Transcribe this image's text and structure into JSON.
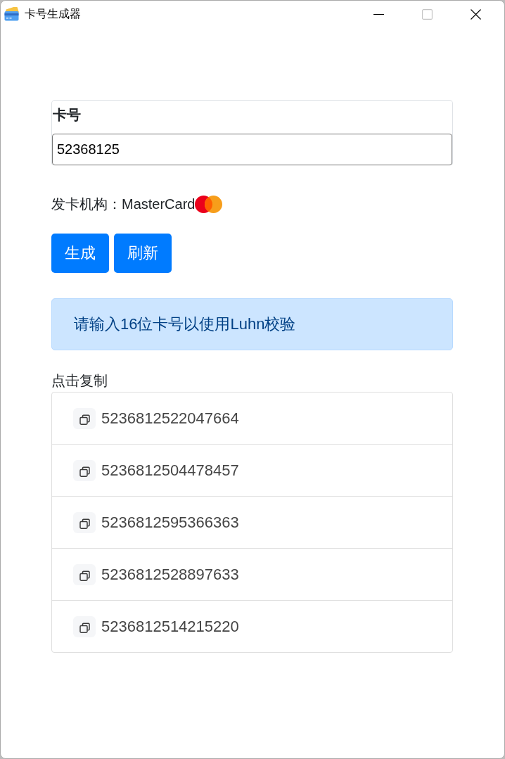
{
  "window": {
    "title": "卡号生成器",
    "maximize_disabled": true
  },
  "card_number": {
    "label": "卡号",
    "value": "52368125"
  },
  "issuer": {
    "label": "发卡机构：",
    "value": "MasterCard"
  },
  "buttons": [
    "生成",
    "刷新"
  ],
  "alert": {
    "text": "请输入16位卡号以使用Luhn校验"
  },
  "results": {
    "title": "点击复制",
    "items": [
      "5236812522047664",
      "5236812504478457",
      "5236812595366363",
      "5236812528897633",
      "5236812514215220"
    ]
  }
}
